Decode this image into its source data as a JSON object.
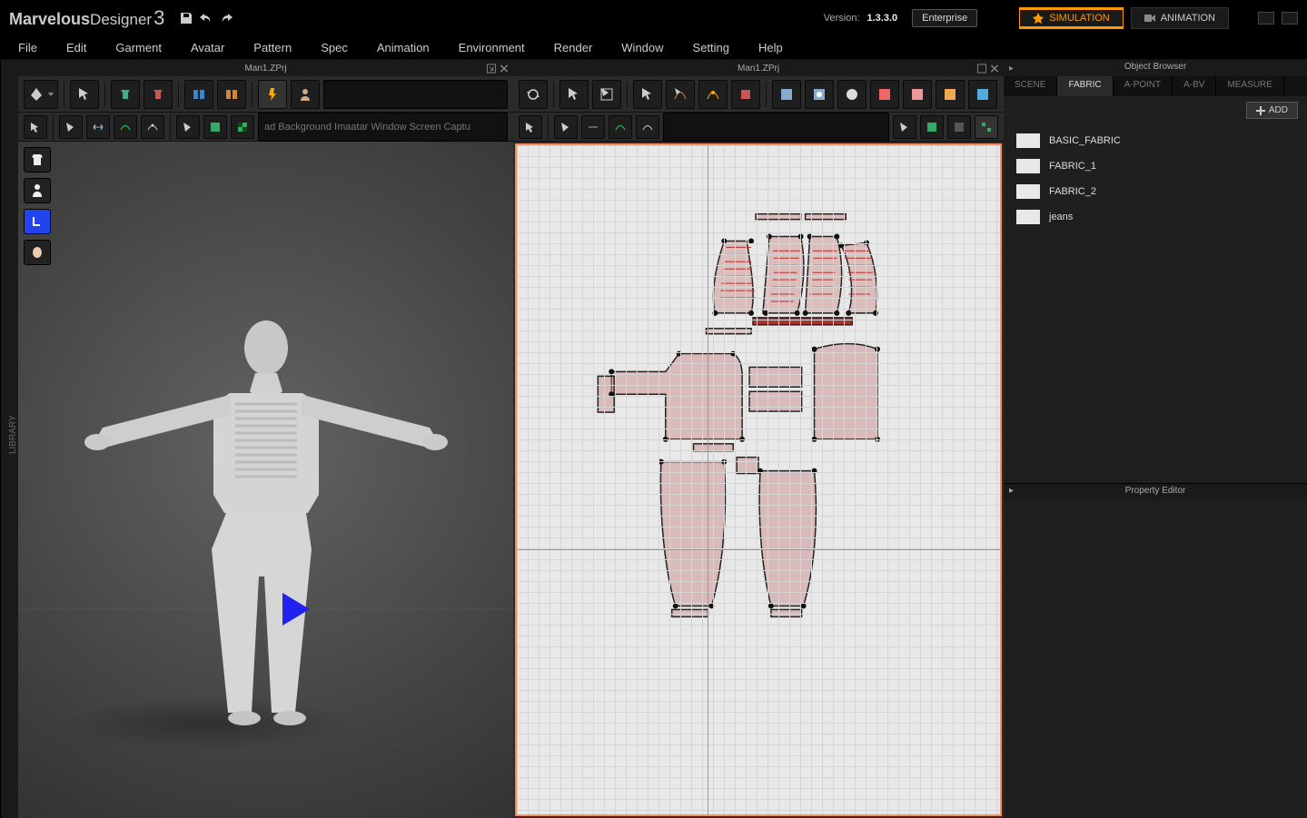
{
  "app": {
    "name_bold": "Marvelous",
    "name_thin": "Designer",
    "version_suffix": "3",
    "version_label": "Version:",
    "version": "1.3.3.0",
    "edition": "Enterprise"
  },
  "modes": {
    "simulation": "SIMULATION",
    "animation": "ANIMATION"
  },
  "menu": [
    "File",
    "Edit",
    "Garment",
    "Avatar",
    "Pattern",
    "Spec",
    "Animation",
    "Environment",
    "Render",
    "Window",
    "Setting",
    "Help"
  ],
  "library_tab": "LIBRARY",
  "panels": {
    "left_title": "Man1.ZPrj",
    "right_title": "Man1.ZPrj"
  },
  "toolbar3d_hint": "ad Background Imaatar Window Screen Captu",
  "browser": {
    "title": "Object Browser",
    "tabs": [
      "SCENE",
      "FABRIC",
      "A-POINT",
      "A-BV",
      "MEASURE"
    ],
    "active_tab": "FABRIC",
    "add_label": "ADD",
    "fabrics": [
      "BASIC_FABRIC",
      "FABRIC_1",
      "FABRIC_2",
      "jeans"
    ]
  },
  "property_editor": {
    "title": "Property Editor"
  }
}
